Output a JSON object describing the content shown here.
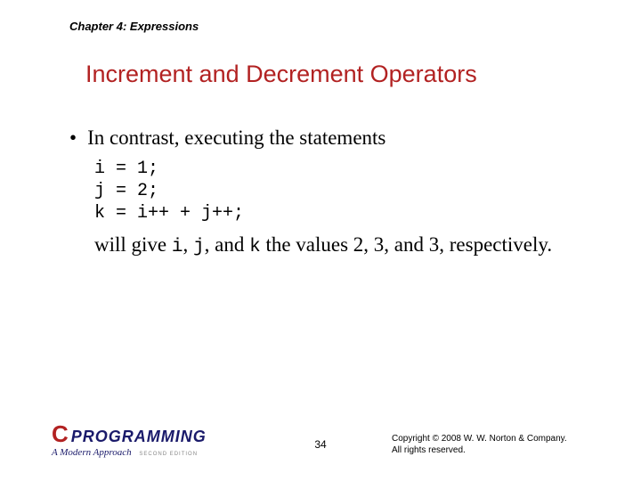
{
  "chapter_header": "Chapter 4: Expressions",
  "slide_title": "Increment and Decrement Operators",
  "bullet_intro": "In contrast, executing the statements",
  "code_lines": "i = 1;\nj = 2;\nk = i++ + j++;",
  "followup": {
    "prefix": "will give ",
    "v1": "i",
    "mid1": ", ",
    "v2": "j",
    "mid2": ", and ",
    "v3": "k",
    "suffix": " the values 2, 3, and 3, respectively."
  },
  "logo": {
    "c": "C",
    "word": "PROGRAMMING",
    "sub": "A Modern Approach",
    "edition": "SECOND EDITION"
  },
  "page_number": "34",
  "copyright_l1": "Copyright © 2008 W. W. Norton & Company.",
  "copyright_l2": "All rights reserved."
}
